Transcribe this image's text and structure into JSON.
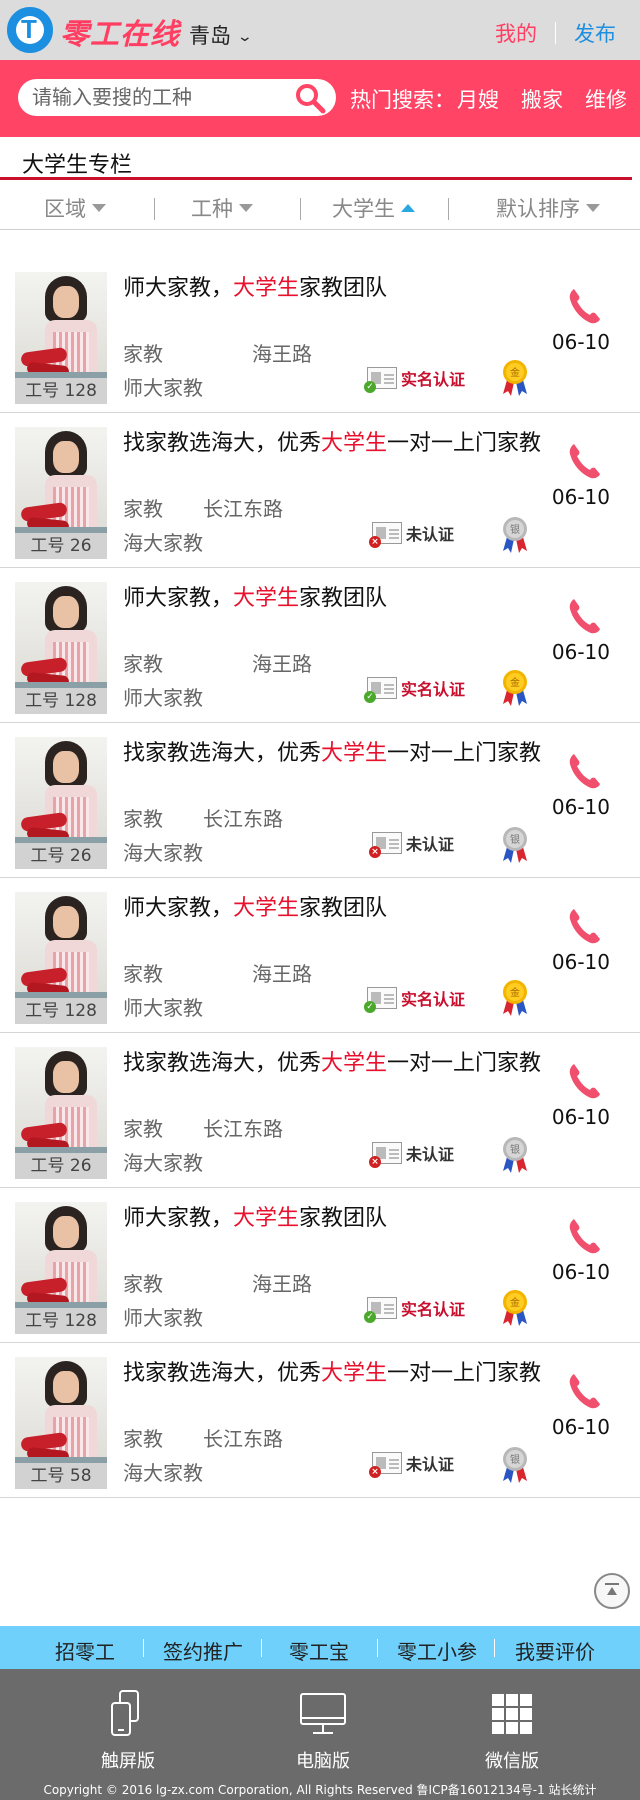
{
  "header": {
    "logo_text": "零工在线",
    "city": "青岛",
    "link_mine": "我的",
    "link_publish": "发布"
  },
  "search": {
    "placeholder": "请输入要搜的工种",
    "hot_label": "热门搜索：",
    "hot_keywords": [
      "月嫂",
      "搬家",
      "维修"
    ]
  },
  "section": {
    "title": "大学生专栏"
  },
  "filters": [
    "区域",
    "工种",
    "大学生",
    "默认排序"
  ],
  "listings": [
    {
      "title_pre": "师大家教，",
      "title_hl": "大学生",
      "title_post": "家教团队",
      "kind": "家教",
      "road": "海王路",
      "org": "师大家教",
      "worker_id": "工号 128",
      "date": "06-10",
      "cert": "实名认证",
      "medal": "金",
      "cert_ok": true
    },
    {
      "title_pre": "找家教选海大，优秀",
      "title_hl": "大学生",
      "title_post": "一对一上门家教",
      "kind": "家教",
      "road": "长江东路",
      "org": "海大家教",
      "worker_id": "工号  26",
      "date": "06-10",
      "cert": "未认证",
      "medal": "银",
      "cert_ok": false
    },
    {
      "title_pre": "师大家教，",
      "title_hl": "大学生",
      "title_post": "家教团队",
      "kind": "家教",
      "road": "海王路",
      "org": "师大家教",
      "worker_id": "工号 128",
      "date": "06-10",
      "cert": "实名认证",
      "medal": "金",
      "cert_ok": true
    },
    {
      "title_pre": "找家教选海大，优秀",
      "title_hl": "大学生",
      "title_post": "一对一上门家教",
      "kind": "家教",
      "road": "长江东路",
      "org": "海大家教",
      "worker_id": "工号  26",
      "date": "06-10",
      "cert": "未认证",
      "medal": "银",
      "cert_ok": false
    },
    {
      "title_pre": "师大家教，",
      "title_hl": "大学生",
      "title_post": "家教团队",
      "kind": "家教",
      "road": "海王路",
      "org": "师大家教",
      "worker_id": "工号 128",
      "date": "06-10",
      "cert": "实名认证",
      "medal": "金",
      "cert_ok": true
    },
    {
      "title_pre": "找家教选海大，优秀",
      "title_hl": "大学生",
      "title_post": "一对一上门家教",
      "kind": "家教",
      "road": "长江东路",
      "org": "海大家教",
      "worker_id": "工号  26",
      "date": "06-10",
      "cert": "未认证",
      "medal": "银",
      "cert_ok": false
    },
    {
      "title_pre": "师大家教，",
      "title_hl": "大学生",
      "title_post": "家教团队",
      "kind": "家教",
      "road": "海王路",
      "org": "师大家教",
      "worker_id": "工号 128",
      "date": "06-10",
      "cert": "实名认证",
      "medal": "金",
      "cert_ok": true
    },
    {
      "title_pre": "找家教选海大，优秀",
      "title_hl": "大学生",
      "title_post": "一对一上门家教",
      "kind": "家教",
      "road": "长江东路",
      "org": "海大家教",
      "worker_id": "工号  58",
      "date": "06-10",
      "cert": "未认证",
      "medal": "银",
      "cert_ok": false
    }
  ],
  "bottom_nav": [
    "招零工",
    "签约推广",
    "零工宝",
    "零工小参",
    "我要评价"
  ],
  "footer": {
    "items": [
      "触屏版",
      "电脑版",
      "微信版"
    ],
    "copyright": "Copyright © 2016 lg-zx.com Corporation, All Rights Reserved 鲁ICP备16012134号-1 站长统计"
  },
  "colors": {
    "brand": "#ff4466",
    "accent_blue": "#1d8fe0",
    "highlight_red": "#e8112d",
    "nav_blue": "#6ed0fb",
    "footer_gray": "#6b6b6b"
  }
}
